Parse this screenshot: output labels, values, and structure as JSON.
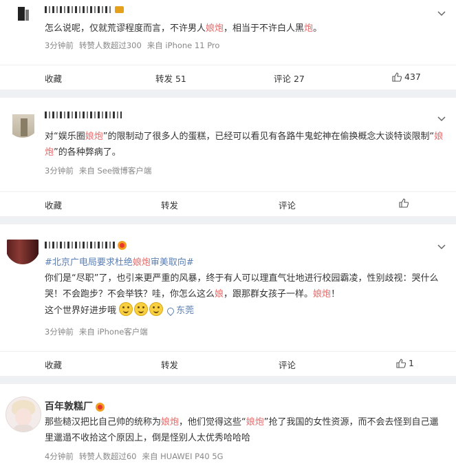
{
  "posts": [
    {
      "text_parts": [
        "怎么说呢，仅就荒谬程度而言，不许男人",
        "娘炮",
        "，相当于不许白人黑",
        "炮",
        "。"
      ],
      "meta": [
        "3分钟前",
        "转赞人数超过300",
        "来自 iPhone 11 Pro"
      ],
      "actions": {
        "collect": "收藏",
        "repost": "转发 51",
        "comment": "评论 27",
        "like": "437"
      }
    },
    {
      "text_parts": [
        "对“娱乐圈",
        "娘炮",
        "”的限制动了很多人的蛋糕，已经可以看见有各路牛鬼蛇神在偷换概念大谈特谈限制“",
        "娘炮",
        "”的各种弊病了。"
      ],
      "meta": [
        "3分钟前",
        "来自 See微博客户端"
      ],
      "actions": {
        "collect": "收藏",
        "repost": "转发",
        "comment": "评论",
        "like": ""
      }
    },
    {
      "topic_parts": [
        "#北京广电局要求杜绝",
        "娘炮",
        "审美取向#"
      ],
      "text_parts": [
        "你们是“尽职”了，也引来更严重的风暴，终于有人可以理直气壮地进行校园霸凌，性别歧视：哭什么哭！不会跑步？不会举铁？哇，你怎么这么",
        "娘",
        "，跟那群女孩子一样。",
        "娘炮",
        "！"
      ],
      "line3": "这个世界好进步哦",
      "location": "东莞",
      "meta": [
        "3分钟前",
        "来自 iPhone客户端"
      ],
      "actions": {
        "collect": "收藏",
        "repost": "转发",
        "comment": "评论",
        "like": "1"
      }
    },
    {
      "name": "百年敦糕厂",
      "text_parts": [
        "那些糙汉把比自己帅的统称为",
        "娘炮",
        "，他们觉得这些“",
        "娘炮",
        "”抢了我国的女性资源，而不会去怪到自己邋里邋遢不收拾这个原因上，倒是怪别人太优秀哈哈哈"
      ],
      "meta": [
        "4分钟前",
        "转赞人数超过60",
        "来自 HUAWEI P40 5G"
      ]
    }
  ]
}
